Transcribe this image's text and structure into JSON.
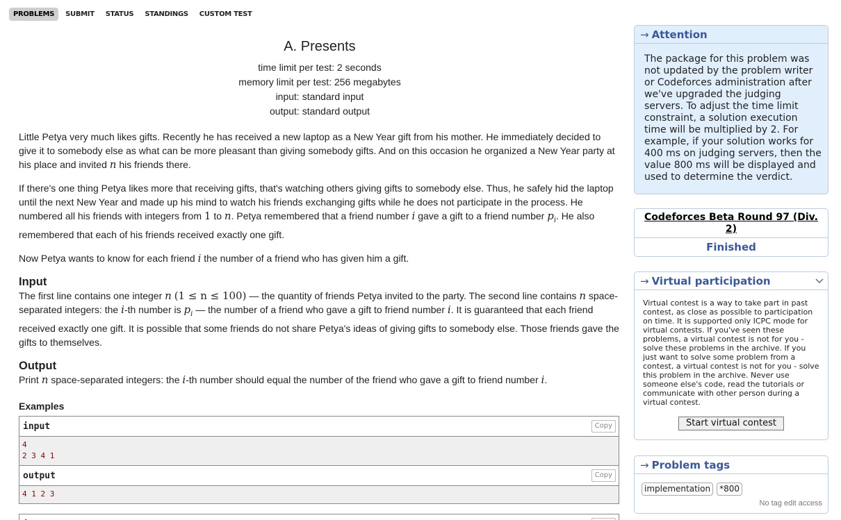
{
  "nav": {
    "items": [
      "PROBLEMS",
      "SUBMIT",
      "STATUS",
      "STANDINGS",
      "CUSTOM TEST"
    ],
    "active": "PROBLEMS"
  },
  "problem": {
    "title": "A. Presents",
    "time_limit": "time limit per test: 2 seconds",
    "memory_limit": "memory limit per test: 256 megabytes",
    "input": "input: standard input",
    "output": "output: standard output",
    "legend": {
      "p1_a": "Little Petya very much likes gifts. Recently he has received a new laptop as a New Year gift from his mother. He immediately decided to give it to somebody else as what can be more pleasant than giving somebody gifts. And on this occasion he organized a New Year party at his place and invited ",
      "p1_n": "n",
      "p1_b": " his friends there.",
      "p2_a": "If there's one thing Petya likes more that receiving gifts, that's watching others giving gifts to somebody else. Thus, he safely hid the laptop until the next New Year and made up his mind to watch his friends exchanging gifts while he does not participate in the process. He numbered all his friends with integers from ",
      "p2_one": "1",
      "p2_to": " to ",
      "p2_n": "n",
      "p2_b": ". Petya remembered that a friend number ",
      "p2_i": "i",
      "p2_c": " gave a gift to a friend number ",
      "p2_p": "p",
      "p2_pi": "i",
      "p2_d": ". He also remembered that each of his friends received exactly one gift.",
      "p3_a": "Now Petya wants to know for each friend ",
      "p3_i": "i",
      "p3_b": " the number of a friend who has given him a gift."
    },
    "input_section": {
      "title": "Input",
      "a": "The first line contains one integer ",
      "n": "n",
      "constraint": "(1 ≤ n ≤ 100)",
      "b": " — the quantity of friends Petya invited to the party. The second line contains ",
      "n2": "n",
      "c": " space-separated integers: the ",
      "i": "i",
      "d": "-th number is ",
      "p": "p",
      "pi": "i",
      "e": " — the number of a friend who gave a gift to friend number ",
      "i2": "i",
      "f": ". It is guaranteed that each friend received exactly one gift. It is possible that some friends do not share Petya's ideas of giving gifts to somebody else. Those friends gave the gifts to themselves."
    },
    "output_section": {
      "title": "Output",
      "a": "Print ",
      "n": "n",
      "b": " space-separated integers: the ",
      "i": "i",
      "c": "-th number should equal the number of the friend who gave a gift to friend number ",
      "i2": "i",
      "d": "."
    },
    "examples_title": "Examples",
    "examples": [
      {
        "input_label": "input",
        "input": "4\n2 3 4 1",
        "output_label": "output",
        "output": "4 1 2 3"
      },
      {
        "input_label": "input"
      }
    ],
    "copy_label": "Copy"
  },
  "sidebar": {
    "attention": {
      "arrow": "→",
      "title": "Attention",
      "text": "The package for this problem was not updated by the problem writer or Codeforces administration after we've upgraded the judging servers. To adjust the time limit constraint, a solution execution time will be multiplied by 2. For example, if your solution works for 400 ms on judging servers, then the value 800 ms will be displayed and used to determine the verdict."
    },
    "contest": {
      "name": "Codeforces Beta Round 97 (Div. 2)",
      "phase": "Finished"
    },
    "virtual": {
      "arrow": "→",
      "title": "Virtual participation",
      "text": "Virtual contest is a way to take part in past contest, as close as possible to participation on time. It is supported only ICPC mode for virtual contests. If you've seen these problems, a virtual contest is not for you - solve these problems in the archive. If you just want to solve some problem from a contest, a virtual contest is not for you - solve this problem in the archive. Never use someone else's code, read the tutorials or communicate with other person during a virtual contest.",
      "button": "Start virtual contest"
    },
    "tags": {
      "arrow": "→",
      "title": "Problem tags",
      "items": [
        "implementation",
        "*800"
      ],
      "no_edit": "No tag edit access"
    }
  }
}
